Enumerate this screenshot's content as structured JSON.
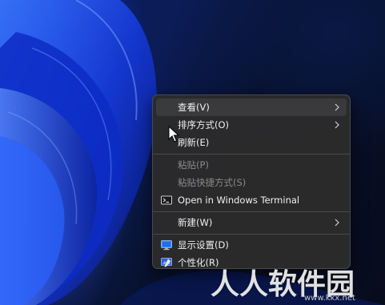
{
  "context_menu": {
    "items": [
      {
        "label": "查看(V)",
        "has_submenu": true
      },
      {
        "label": "排序方式(O)",
        "has_submenu": true
      },
      {
        "label": "刷新(E)"
      },
      {
        "label": "粘贴(P)",
        "disabled": true
      },
      {
        "label": "粘贴快捷方式(S)",
        "disabled": true
      },
      {
        "label": "Open in Windows Terminal",
        "icon": "terminal-icon"
      },
      {
        "label": "新建(W)",
        "has_submenu": true
      },
      {
        "label": "显示设置(D)",
        "icon": "display-settings-icon"
      },
      {
        "label": "个性化(R)",
        "icon": "personalize-icon"
      }
    ]
  },
  "watermark": {
    "text": "人人软件园",
    "url": "www.kkx.net"
  },
  "colors": {
    "menu_background": "#2c2c2c",
    "menu_text": "#f0f0f0",
    "menu_text_disabled": "#8a8a8a",
    "wallpaper_accent": "#1e4cff"
  }
}
